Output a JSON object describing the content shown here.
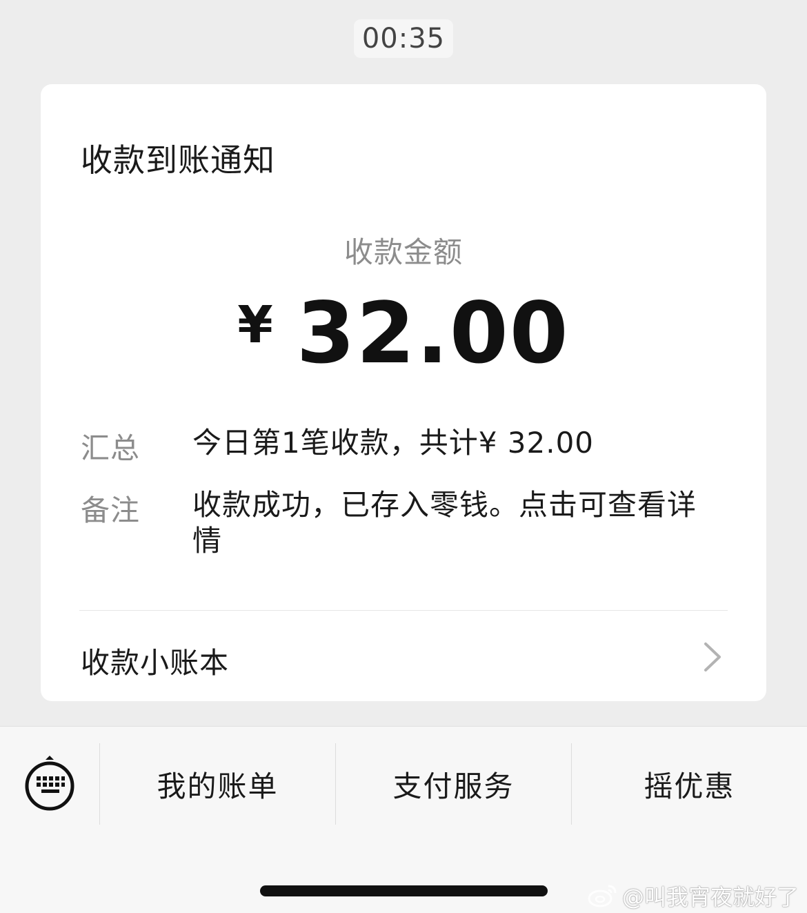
{
  "timestamp": "00:35",
  "card": {
    "title": "收款到账通知",
    "amount_label": "收款金额",
    "currency": "¥",
    "amount": "32.00",
    "summary_label": "汇总",
    "summary_value": "今日第1笔收款，共计¥ 32.00",
    "note_label": "备注",
    "note_value": "收款成功，已存入零钱。点击可查看详情",
    "ledger_label": "收款小账本"
  },
  "bottom_menu": {
    "items": [
      {
        "label": "我的账单"
      },
      {
        "label": "支付服务"
      },
      {
        "label": "摇优惠"
      }
    ]
  },
  "watermark": "@叫我宵夜就好了",
  "icons": [
    "keyboard-icon",
    "chevron-right-icon",
    "weibo-icon"
  ]
}
